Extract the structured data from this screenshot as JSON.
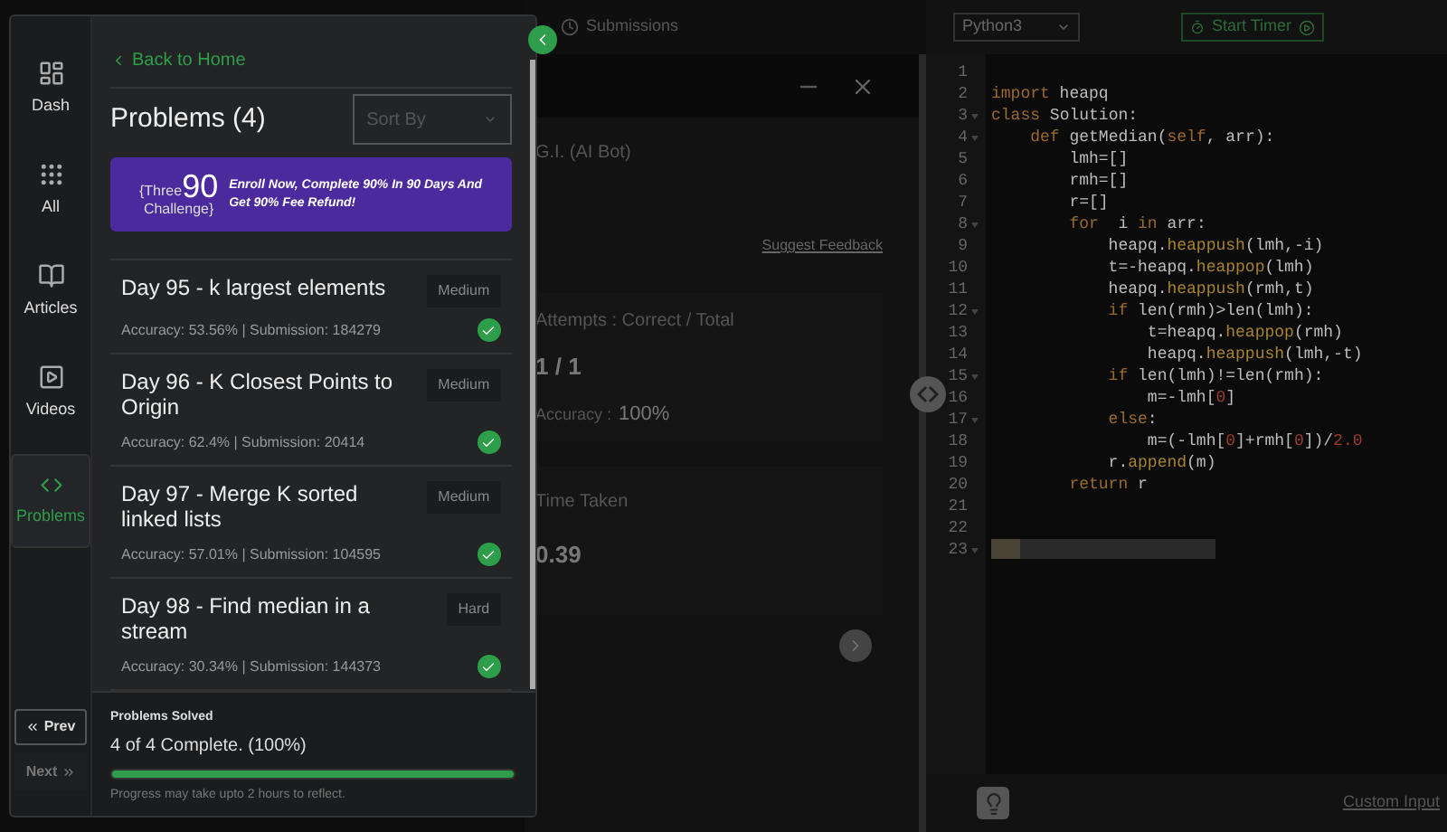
{
  "nav": {
    "items": [
      {
        "label": "Dash",
        "selected": false
      },
      {
        "label": "All",
        "selected": false
      },
      {
        "label": "Articles",
        "selected": false
      },
      {
        "label": "Videos",
        "selected": false
      },
      {
        "label": "Problems",
        "selected": true
      }
    ],
    "prev": "Prev",
    "next": "Next"
  },
  "problems_panel": {
    "back_link": "Back to Home",
    "title": "Problems (4)",
    "sort": {
      "placeholder": "Sort By"
    },
    "banner": {
      "logo_top": "{Three",
      "logo_number": "90",
      "logo_bottom": "Challenge}",
      "text": "Enroll Now, Complete 90% In 90 Days And Get 90% Fee Refund!"
    },
    "problems": [
      {
        "title": "Day 95 - k largest elements",
        "difficulty": "Medium",
        "stats": "Accuracy: 53.56% | Submission: 184279",
        "solved": true
      },
      {
        "title": "Day 96 - K Closest Points to Origin",
        "difficulty": "Medium",
        "stats": "Accuracy: 62.4% | Submission: 20414",
        "solved": true
      },
      {
        "title": "Day 97 - Merge K sorted linked lists",
        "difficulty": "Medium",
        "stats": "Accuracy: 57.01% | Submission: 104595",
        "solved": true
      },
      {
        "title": "Day 98 - Find median in a stream",
        "difficulty": "Hard",
        "stats": "Accuracy: 30.34% | Submission: 144373",
        "solved": true
      }
    ]
  },
  "progress": {
    "label": "Problems Solved",
    "summary": "4 of 4 Complete. (100%)",
    "level": 1,
    "note": "Progress may take upto 2 hours to reflect."
  },
  "tabs": [
    {
      "label": "Submissions"
    }
  ],
  "result_panel": {
    "bot": "G.I. (AI Bot)",
    "feedback_link": "Suggest Feedback",
    "attempts_label": "Attempts : Correct / Total",
    "attempts_value": "1 / 1",
    "accuracy_label": "Accuracy :",
    "accuracy_value": "100%",
    "time_label": "Time Taken",
    "time_value": "0.39"
  },
  "editor": {
    "language": "Python3",
    "timer_button": "Start Timer",
    "custom_input": "Custom Input",
    "lines": [
      {
        "number": "1",
        "fold": false
      },
      {
        "number": "2",
        "fold": false,
        "tokens": [
          {
            "text": "import",
            "kind": "kw"
          },
          {
            "text": " heapq",
            "kind": "plain"
          }
        ]
      },
      {
        "number": "3",
        "fold": true,
        "tokens": [
          {
            "text": "class",
            "kind": "kw"
          },
          {
            "text": " Solution:",
            "kind": "plain"
          }
        ]
      },
      {
        "number": "4",
        "fold": true,
        "tokens": [
          {
            "text": "    def",
            "kind": "kw"
          },
          {
            "text": " getMedian(",
            "kind": "plain"
          },
          {
            "text": "self",
            "kind": "kw"
          },
          {
            "text": ", arr):",
            "kind": "plain"
          }
        ]
      },
      {
        "number": "5",
        "fold": false,
        "tokens": [
          {
            "text": "        lmh=[]",
            "kind": "plain"
          }
        ]
      },
      {
        "number": "6",
        "fold": false,
        "tokens": [
          {
            "text": "        rmh=[]",
            "kind": "plain"
          }
        ]
      },
      {
        "number": "7",
        "fold": false,
        "tokens": [
          {
            "text": "        r=[]",
            "kind": "plain"
          }
        ]
      },
      {
        "number": "8",
        "fold": true,
        "tokens": [
          {
            "text": "        for",
            "kind": "kw"
          },
          {
            "text": "  i ",
            "kind": "plain"
          },
          {
            "text": "in",
            "kind": "kw"
          },
          {
            "text": " arr:",
            "kind": "plain"
          }
        ]
      },
      {
        "number": "9",
        "fold": false,
        "tokens": [
          {
            "text": "            heapq.",
            "kind": "plain"
          },
          {
            "text": "heappush",
            "kind": "fn"
          },
          {
            "text": "(lmh,-i)",
            "kind": "plain"
          }
        ]
      },
      {
        "number": "10",
        "fold": false,
        "tokens": [
          {
            "text": "            t=-heapq.",
            "kind": "plain"
          },
          {
            "text": "heappop",
            "kind": "fn"
          },
          {
            "text": "(lmh)",
            "kind": "plain"
          }
        ]
      },
      {
        "number": "11",
        "fold": false,
        "tokens": [
          {
            "text": "            heapq.",
            "kind": "plain"
          },
          {
            "text": "heappush",
            "kind": "fn"
          },
          {
            "text": "(rmh,t)",
            "kind": "plain"
          }
        ]
      },
      {
        "number": "12",
        "fold": true,
        "tokens": [
          {
            "text": "            if",
            "kind": "kw"
          },
          {
            "text": " len(rmh)>len(lmh):",
            "kind": "plain"
          }
        ]
      },
      {
        "number": "13",
        "fold": false,
        "tokens": [
          {
            "text": "                t=heapq.",
            "kind": "plain"
          },
          {
            "text": "heappop",
            "kind": "fn"
          },
          {
            "text": "(rmh)",
            "kind": "plain"
          }
        ]
      },
      {
        "number": "14",
        "fold": false,
        "tokens": [
          {
            "text": "                heapq.",
            "kind": "plain"
          },
          {
            "text": "heappush",
            "kind": "fn"
          },
          {
            "text": "(lmh,-t)",
            "kind": "plain"
          }
        ]
      },
      {
        "number": "15",
        "fold": true,
        "tokens": [
          {
            "text": "            if",
            "kind": "kw"
          },
          {
            "text": " len(lmh)!=len(rmh):",
            "kind": "plain"
          }
        ]
      },
      {
        "number": "16",
        "fold": false,
        "tokens": [
          {
            "text": "                m=-lmh[",
            "kind": "plain"
          },
          {
            "text": "0",
            "kind": "num"
          },
          {
            "text": "]",
            "kind": "plain"
          }
        ]
      },
      {
        "number": "17",
        "fold": true,
        "tokens": [
          {
            "text": "            else",
            "kind": "kw"
          },
          {
            "text": ":",
            "kind": "plain"
          }
        ]
      },
      {
        "number": "18",
        "fold": false,
        "tokens": [
          {
            "text": "                m=(-lmh[",
            "kind": "plain"
          },
          {
            "text": "0",
            "kind": "num"
          },
          {
            "text": "]+rmh[",
            "kind": "plain"
          },
          {
            "text": "0",
            "kind": "num"
          },
          {
            "text": "])/",
            "kind": "plain"
          },
          {
            "text": "2.0",
            "kind": "num"
          }
        ]
      },
      {
        "number": "19",
        "fold": false,
        "tokens": [
          {
            "text": "            r.",
            "kind": "plain"
          },
          {
            "text": "append",
            "kind": "fn"
          },
          {
            "text": "(m)",
            "kind": "plain"
          }
        ]
      },
      {
        "number": "20",
        "fold": false,
        "tokens": [
          {
            "text": "        return",
            "kind": "kw"
          },
          {
            "text": " r",
            "kind": "plain"
          }
        ]
      },
      {
        "number": "21",
        "fold": false
      },
      {
        "number": "22",
        "fold": false
      },
      {
        "number": "23",
        "fold": true,
        "highlight": true
      }
    ]
  }
}
